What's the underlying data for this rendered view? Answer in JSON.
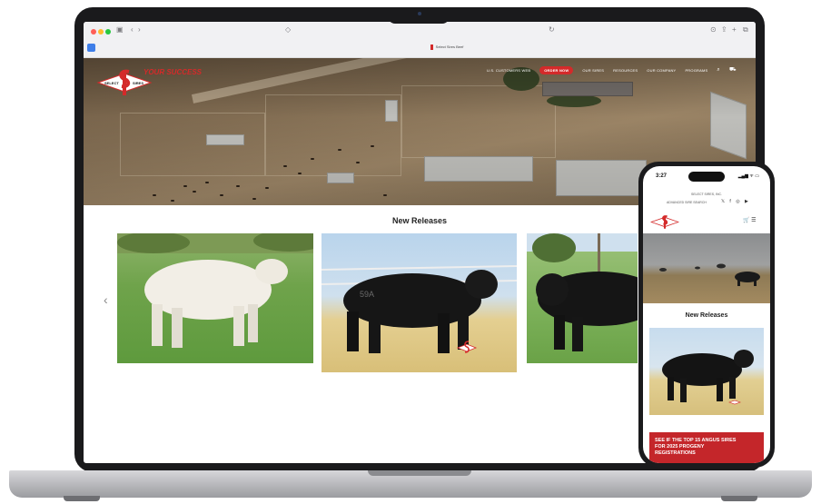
{
  "browser": {
    "tab_title": "Select Sires Beef"
  },
  "site": {
    "logo_top": "SELECT",
    "logo_bottom": "SIRES",
    "logo_tagline": "YOUR SUCCESS",
    "nav": {
      "item_1": "U.S. CUSTOMERS WEB",
      "order_button": "ORDER NOW",
      "item_2": "OUR SIRES",
      "item_3": "RESOURCES",
      "item_4": "OUR COMPANY",
      "item_5": "PROGRAMS",
      "search_icon": "search-icon",
      "cart_icon": "cart-icon"
    },
    "section_title": "New Releases",
    "carousel_prev": "‹",
    "bull_tag": "59A"
  },
  "phone": {
    "time": "3:27",
    "status": "▂▄▆ ᯤ ▭",
    "company_line": "SELECT SIRES, INC.",
    "links_line": "ADVANCED SIRE SEARCH",
    "socials": "𝕏 f ◎ ▶",
    "icons": "🛒 ☰",
    "section_title": "New Releases",
    "banner_text": "SEE IF THE TOP 15 ANGUS SIRES FOR 2025 PROGENY REGISTRATIONS"
  },
  "colors": {
    "brand_red": "#d42a2a",
    "text_dark": "#222222"
  }
}
